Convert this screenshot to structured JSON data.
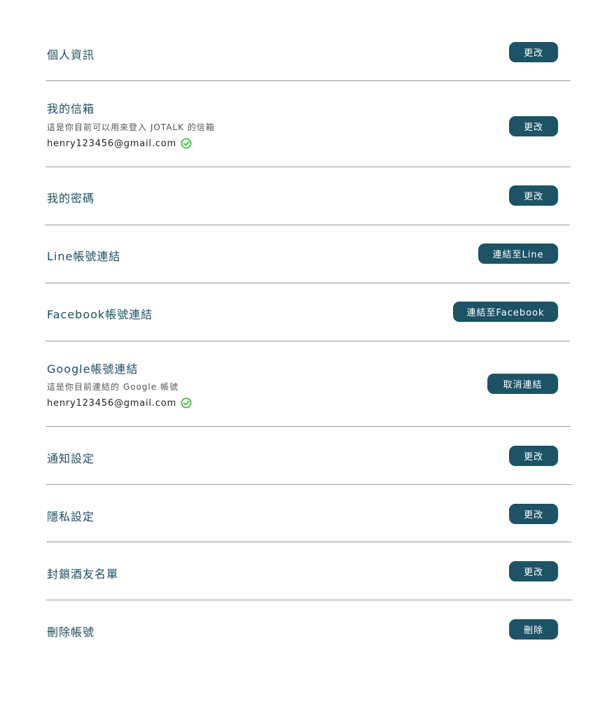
{
  "colors": {
    "accent": "#1d5366",
    "text": "#1d4f60",
    "check": "#3cc13b"
  },
  "sections": {
    "profile": {
      "title": "個人資訊",
      "button": "更改"
    },
    "email": {
      "title": "我的信箱",
      "description": "這是你目前可以用來登入 JOTALK 的信箱",
      "value": "henry123456@gmail.com",
      "button": "更改",
      "verified_icon": "check-circle-icon"
    },
    "password": {
      "title": "我的密碼",
      "button": "更改"
    },
    "line": {
      "title": "Line帳號連結",
      "button": "連結至Line"
    },
    "facebook": {
      "title": "Facebook帳號連結",
      "button": "連結至Facebook"
    },
    "google": {
      "title": "Google帳號連結",
      "description": "這是你目前連結的 Google 帳號",
      "value": "henry123456@gmail.com",
      "button": "取消連結",
      "verified_icon": "check-circle-icon"
    },
    "notifications": {
      "title": "通知設定",
      "button": "更改"
    },
    "privacy": {
      "title": "隱私設定",
      "button": "更改"
    },
    "blocklist": {
      "title": "封鎖酒友名單",
      "button": "更改"
    },
    "delete": {
      "title": "刪除帳號",
      "button": "刪除"
    }
  }
}
